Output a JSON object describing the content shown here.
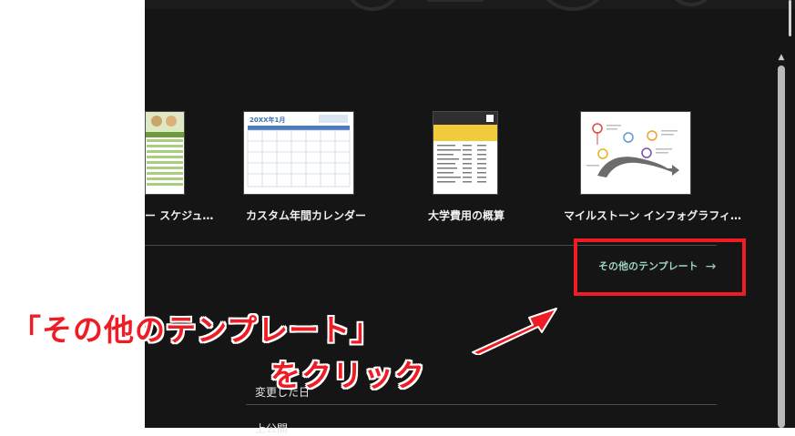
{
  "templates": [
    {
      "label": "ー スケジュ…",
      "thumb": "schedule-thumbnail"
    },
    {
      "label": "カスタム年間カレンダー",
      "thumb": "calendar-thumbnail",
      "title": "20XX年1月"
    },
    {
      "label": "大学費用の概算",
      "thumb": "college-cost-thumbnail"
    },
    {
      "label": "マイルストーン インフォグラフィ…",
      "thumb": "milestone-infographic-thumbnail"
    }
  ],
  "more_templates": {
    "label": "その他のテンプレート",
    "arrow": "→"
  },
  "list_header": {
    "modified": "変更した日"
  },
  "list_partial": "上公開",
  "annotation": {
    "line1": "「その他のテンプレート」",
    "line2": "をクリック"
  },
  "colors": {
    "panel_bg": "#151515",
    "accent_link": "#9fd3be",
    "annotation_red": "#ef1c25"
  }
}
